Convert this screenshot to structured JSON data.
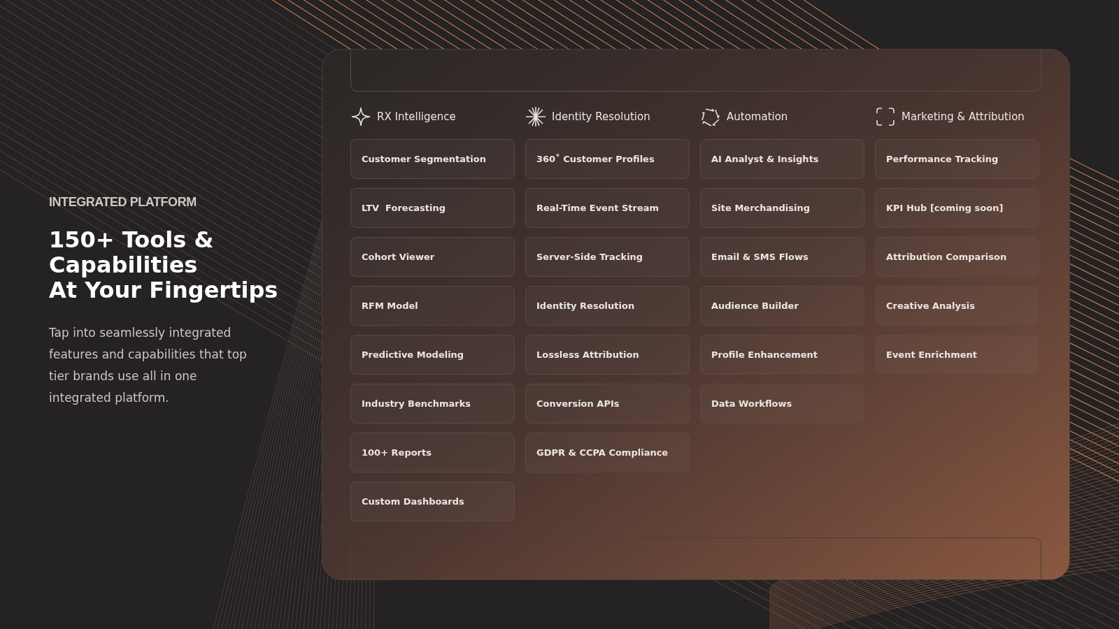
{
  "intro": {
    "eyebrow": "INTEGRATED PLATFORM",
    "heading_lines": [
      "150+ Tools &",
      "Capabilities",
      "At Your Fingertips"
    ],
    "body": "Tap into seamlessly integrated features and capabilities that top tier brands use all in one integrated platform."
  },
  "columns": [
    {
      "title": "RX Intelligence",
      "items": [
        "Customer Segmentation",
        "LTV  Forecasting",
        "Cohort Viewer",
        "RFM Model",
        "Predictive Modeling",
        "Industry Benchmarks",
        "100+ Reports",
        "Custom Dashboards"
      ]
    },
    {
      "title": "Identity Resolution",
      "items": [
        "360˚ Customer Profiles",
        "Real-Time Event Stream",
        "Server-Side Tracking",
        "Identity Resolution",
        "Lossless Attribution",
        "Conversion APIs",
        "GDPR & CCPA Compliance"
      ]
    },
    {
      "title": "Automation",
      "items": [
        "AI Analyst & Insights",
        "Site Merchandising",
        "Email & SMS Flows",
        "Audience Builder",
        "Profile Enhancement",
        "Data Workflows"
      ]
    },
    {
      "title": "Marketing & Attribution",
      "items": [
        "Performance Tracking",
        "KPI Hub [coming soon]",
        "Attribution Comparison",
        "Creative Analysis",
        "Event Enrichment"
      ]
    }
  ]
}
